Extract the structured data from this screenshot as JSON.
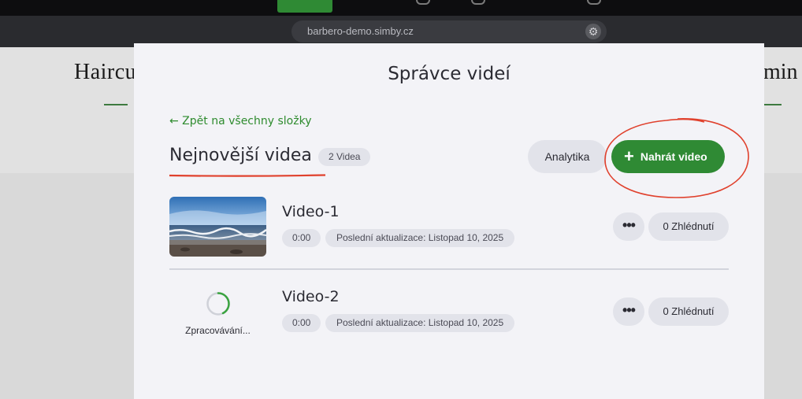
{
  "browser": {
    "url": "barbero-demo.simby.cz"
  },
  "background_page": {
    "left_heading": "Haircu",
    "right_heading": "omin"
  },
  "modal": {
    "title": "Správce videí",
    "back_link": "← Zpět na všechny složky",
    "folder_title": "Nejnovější videa",
    "video_count": "2 Videa",
    "analytics_label": "Analytika",
    "upload_label": "Nahrát video",
    "videos": [
      {
        "title": "Video-1",
        "duration": "0:00",
        "updated": "Poslední aktualizace: Listopad 10, 2025",
        "views": "0 Zhlédnutí",
        "more": "•••",
        "status": "ready"
      },
      {
        "title": "Video-2",
        "duration": "0:00",
        "updated": "Poslední aktualizace: Listopad 10, 2025",
        "views": "0 Zhlédnutí",
        "more": "•••",
        "status": "processing",
        "processing_label": "Zpracovávání..."
      }
    ]
  },
  "colors": {
    "accent": "#2f8a34",
    "annotation": "#e0412d",
    "modal_bg": "#f3f3f7",
    "pill_bg": "#e2e3ea"
  }
}
